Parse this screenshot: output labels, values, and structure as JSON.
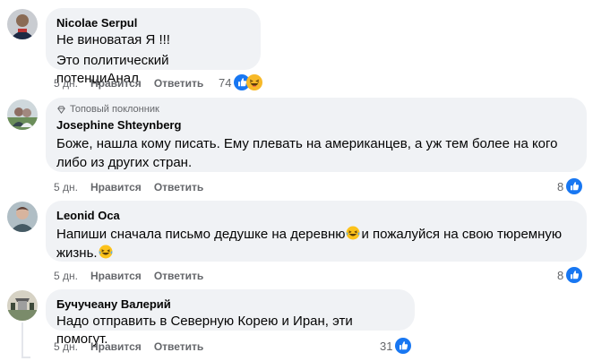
{
  "comments": [
    {
      "author": "Nicolae Serpul",
      "lines": [
        "Не виноватая Я !!!",
        "Это политический потенциАнал"
      ],
      "time": "5 дн.",
      "like": "Нравится",
      "reply": "Ответить",
      "count": "74",
      "reactions": [
        "like-icon",
        "haha-icon"
      ]
    },
    {
      "badge": "Топовый поклонник",
      "author": "Josephine Shteynberg",
      "lines": [
        "Боже, нашла кому писать. Ему плевать на американцев, а уж тем более на кого",
        "либо из других стран."
      ],
      "time": "5 дн.",
      "like": "Нравится",
      "reply": "Ответить",
      "count": "8",
      "reactions": [
        "like-icon"
      ]
    },
    {
      "author": "Leonid Oca",
      "line1_a": "Напиши сначала письмо дедушке на деревню",
      "line1_b": "и пожалуйся на свою тюремную",
      "line2": "жизнь.",
      "time": "5 дн.",
      "like": "Нравится",
      "reply": "Ответить",
      "count": "8",
      "reactions": [
        "like-icon"
      ]
    },
    {
      "author": "Бучучеану Валерий",
      "lines": [
        "Надо отправить в Северную Корею и Иран, эти помогут."
      ],
      "time": "5 дн.",
      "like": "Нравится",
      "reply": "Ответить",
      "count": "31",
      "reactions": [
        "like-icon"
      ]
    }
  ],
  "colors": {
    "bubble": "#f0f2f5",
    "like_blue": "#1877f2",
    "muted": "#65676b",
    "haha_yellow": "#f7b928"
  }
}
